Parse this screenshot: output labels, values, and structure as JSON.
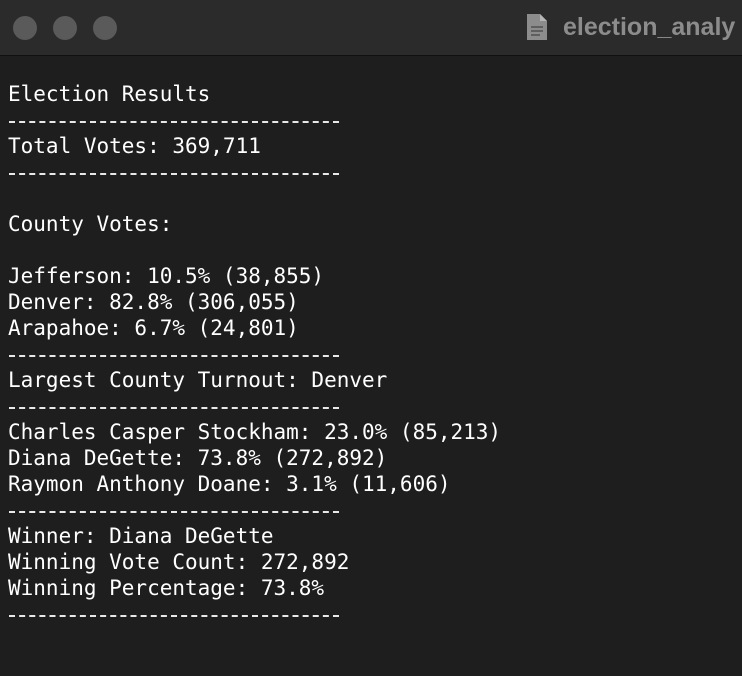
{
  "window": {
    "title": "election_analy"
  },
  "output": {
    "heading": "Election Results",
    "total_votes": "Total Votes: 369,711",
    "county_header": "County Votes:",
    "counties": [
      "Jefferson: 10.5% (38,855)",
      "Denver: 82.8% (306,055)",
      "Arapahoe: 6.7% (24,801)"
    ],
    "largest_county": "Largest County Turnout: Denver",
    "candidates": [
      "Charles Casper Stockham: 23.0% (85,213)",
      "Diana DeGette: 73.8% (272,892)",
      "Raymon Anthony Doane: 3.1% (11,606)"
    ],
    "winner": "Winner: Diana DeGette",
    "winning_count": "Winning Vote Count: 272,892",
    "winning_percentage": "Winning Percentage: 73.8%"
  },
  "colors": {
    "background": "#1e1e1e",
    "titlebar": "#2b2b2b",
    "text": "#ffffff",
    "title_text": "#8c8c8c"
  }
}
